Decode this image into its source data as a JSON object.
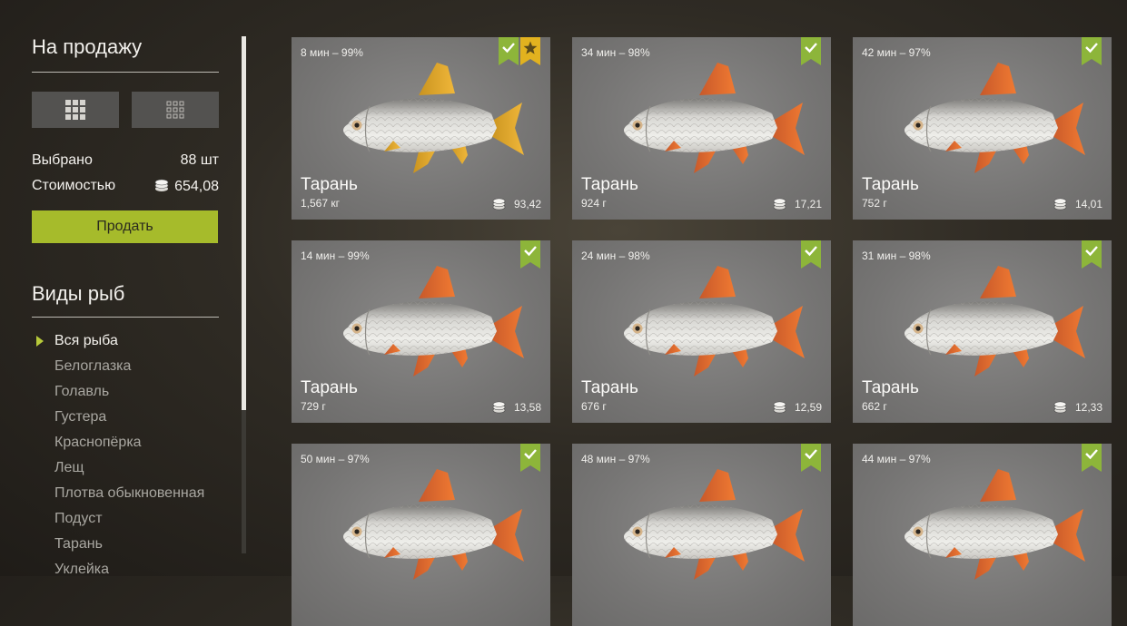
{
  "sidebar": {
    "sale_title": "На продажу",
    "selected_label": "Выбрано",
    "selected_value": "88 шт",
    "cost_label": "Стоимостью",
    "cost_value": "654,08",
    "sell_button": "Продать",
    "species_title": "Виды рыб",
    "species": [
      {
        "label": "Вся рыба",
        "active": true
      },
      {
        "label": "Белоглазка"
      },
      {
        "label": "Голавль"
      },
      {
        "label": "Густера"
      },
      {
        "label": "Краснопёрка"
      },
      {
        "label": "Лещ"
      },
      {
        "label": "Плотва обыкновенная"
      },
      {
        "label": "Подуст"
      },
      {
        "label": "Тарань"
      },
      {
        "label": "Уклейка"
      }
    ]
  },
  "cards": [
    {
      "catch": "8 мин – 99%",
      "name": "Тарань",
      "weight": "1,567 кг",
      "price": "93,42",
      "star": true
    },
    {
      "catch": "34 мин – 98%",
      "name": "Тарань",
      "weight": "924 г",
      "price": "17,21"
    },
    {
      "catch": "42 мин – 97%",
      "name": "Тарань",
      "weight": "752 г",
      "price": "14,01"
    },
    {
      "catch": "14 мин – 99%",
      "name": "Тарань",
      "weight": "729 г",
      "price": "13,58"
    },
    {
      "catch": "24 мин – 98%",
      "name": "Тарань",
      "weight": "676 г",
      "price": "12,59"
    },
    {
      "catch": "31 мин – 98%",
      "name": "Тарань",
      "weight": "662 г",
      "price": "12,33"
    },
    {
      "catch": "50 мин – 97%",
      "name": "",
      "weight": "",
      "price": ""
    },
    {
      "catch": "48 мин – 97%",
      "name": "",
      "weight": "",
      "price": ""
    },
    {
      "catch": "44 мин – 97%",
      "name": "",
      "weight": "",
      "price": ""
    }
  ],
  "icons": {
    "view_large": "grid-large-icon",
    "view_small": "grid-small-icon",
    "coin": "coin-stack-icon",
    "check": "check-badge-icon",
    "star": "star-badge-icon",
    "fish": "roach-fish-image"
  },
  "colors": {
    "accent_green": "#a6bb2b",
    "badge_green": "#8db53a",
    "badge_gold": "#e2b21f"
  }
}
